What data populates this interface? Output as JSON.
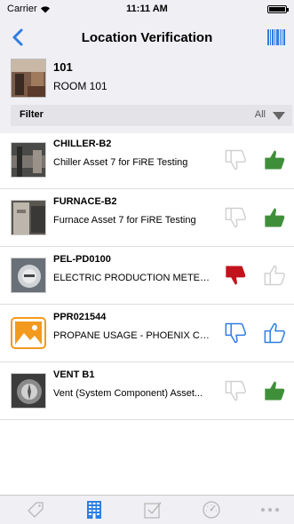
{
  "status_bar": {
    "carrier": "Carrier",
    "time": "11:11 AM"
  },
  "nav": {
    "title": "Location Verification",
    "back_icon": "chevron-left-icon",
    "right_icon": "barcode-icon"
  },
  "location": {
    "code": "101",
    "name": "ROOM 101"
  },
  "filter": {
    "label": "Filter",
    "value": "All"
  },
  "colors": {
    "accent": "#2f7ee0",
    "thumb_up": "#3f8f3a",
    "thumb_down": "#c4121c",
    "inactive": "#cccccc"
  },
  "assets": [
    {
      "code": "CHILLER-B2",
      "description": "Chiller Asset 7 for FiRE Testing",
      "down": "inactive",
      "up": "active"
    },
    {
      "code": "FURNACE-B2",
      "description": "Furnace Asset 7 for FiRE Testing",
      "down": "inactive",
      "up": "active"
    },
    {
      "code": "PEL-PD0100",
      "description": "ELECTRIC PRODUCTION METER...",
      "down": "active",
      "up": "inactive"
    },
    {
      "code": "PPR021544",
      "description": "PROPANE USAGE - PHOENIX CA...",
      "down": "outline-blue",
      "up": "outline-blue"
    },
    {
      "code": "VENT B1",
      "description": "Vent (System Component) Asset...",
      "down": "inactive",
      "up": "active"
    }
  ],
  "tabs": [
    {
      "icon": "tag-icon",
      "active": false
    },
    {
      "icon": "building-icon",
      "active": true
    },
    {
      "icon": "checklist-icon",
      "active": false
    },
    {
      "icon": "gauge-icon",
      "active": false
    },
    {
      "icon": "more-icon",
      "active": false
    }
  ]
}
